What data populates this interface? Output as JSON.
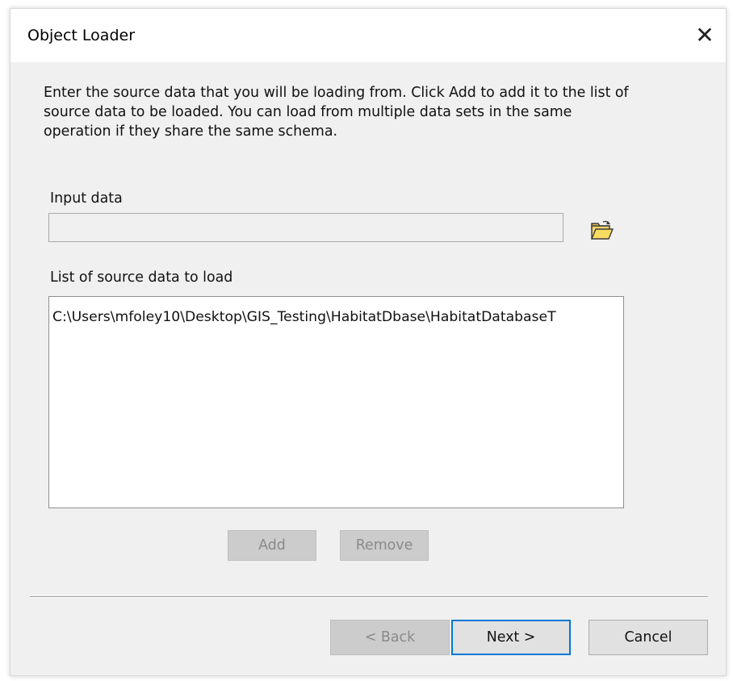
{
  "window": {
    "title": "Object Loader",
    "close_glyph": "✕"
  },
  "instructions": "Enter the source data that you will be loading from. Click Add to add it to the list of source data to be loaded. You can load from multiple data sets in the same operation if they share the same schema.",
  "input": {
    "label": "Input data",
    "value": "",
    "placeholder": "",
    "browse_icon": "open-folder-icon"
  },
  "source_list": {
    "label": "List of source data to load",
    "items": [
      "C:\\Users\\mfoley10\\Desktop\\GIS_Testing\\HabitatDbase\\HabitatDatabaseT"
    ]
  },
  "list_buttons": {
    "add": "Add",
    "remove": "Remove"
  },
  "nav_buttons": {
    "back": "< Back",
    "next": "Next >",
    "cancel": "Cancel"
  },
  "colors": {
    "dialog_bg": "#f0f0f0",
    "titlebar_bg": "#ffffff",
    "default_button_border": "#0078d7",
    "disabled_button_bg": "#cccccc"
  }
}
